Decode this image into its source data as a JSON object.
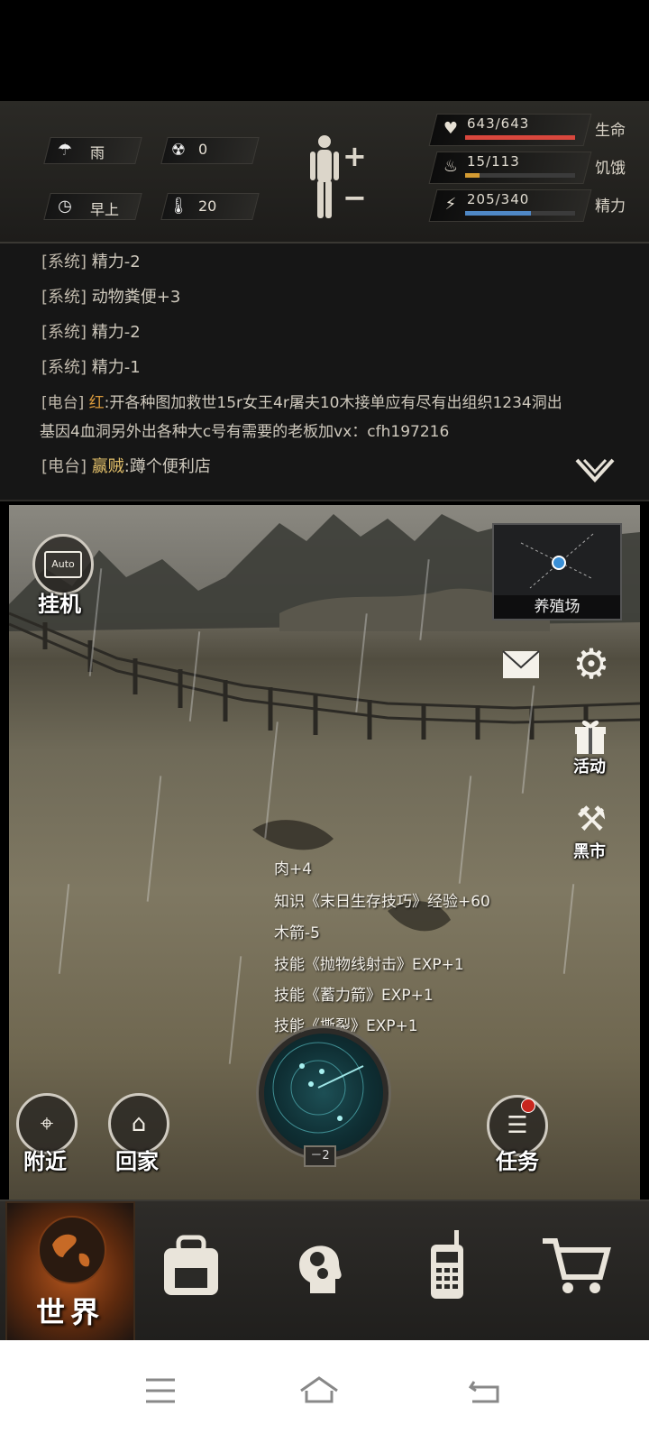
{
  "status": {
    "weather": {
      "icon": "rain-cloud-icon",
      "label": "雨"
    },
    "radiation": {
      "icon": "radiation-icon",
      "value": "0"
    },
    "time": {
      "icon": "clock-icon",
      "label": "早上"
    },
    "temperature": {
      "icon": "thermometer-icon",
      "value": "20"
    },
    "body": {
      "plus": "+",
      "minus": "−"
    },
    "health": {
      "value": "643/643",
      "label": "生命",
      "fill": 1.0,
      "color": "#d9473d"
    },
    "hunger": {
      "value": "15/113",
      "label": "饥饿",
      "fill": 0.13,
      "color": "#d49b32"
    },
    "energy": {
      "value": "205/340",
      "label": "精力",
      "fill": 0.6,
      "color": "#4f88c6"
    }
  },
  "log": [
    {
      "tag": "[系统]",
      "text": "精力-2"
    },
    {
      "tag": "[系统]",
      "text": "动物粪便+3"
    },
    {
      "tag": "[系统]",
      "text": "精力-2"
    },
    {
      "tag": "[系统]",
      "text": "精力-1"
    },
    {
      "tag": "[电台]",
      "speaker": "红",
      "text": ":开各种图加救世15r女王4r屠夫10木接单应有尽有出组织1234洞出",
      "text2": "基因4血洞另外出各种大c号有需要的老板加vx：cfh197216"
    },
    {
      "tag": "[电台]",
      "speaker": "赢贼",
      "text": ":蹲个便利店"
    }
  ],
  "scene": {
    "auto_label": "Auto",
    "idle_label": "挂机",
    "location": "养殖场",
    "activity": "活动",
    "black_market": "黑市",
    "nearby": "附近",
    "home": "回家",
    "tasks": "任务",
    "radar_level": "－2",
    "messages": [
      "肉+4",
      "知识《末日生存技巧》经验+60",
      "木箭-5",
      "技能《抛物线射击》EXP+1",
      "技能《蓄力箭》EXP+1",
      "技能《撕裂》EXP+1"
    ]
  },
  "nav": {
    "world": "世界",
    "items": [
      "backpack-icon",
      "skills-head-icon",
      "radio-icon",
      "cart-icon"
    ]
  }
}
